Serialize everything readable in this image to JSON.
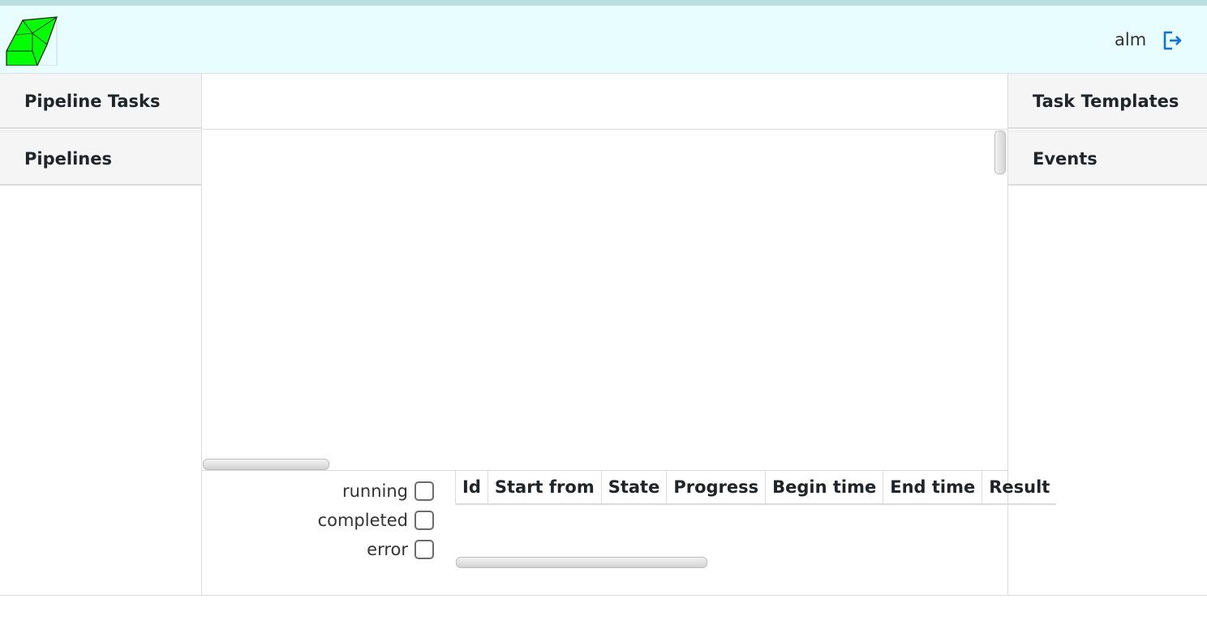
{
  "header": {
    "logo_icon": "green-crystal-logo-icon",
    "user": "alm",
    "logout_icon": "logout-icon",
    "accent_color": "#0d6efd",
    "background_color": "#e8fdff"
  },
  "left_nav": {
    "items": [
      {
        "label": "Pipeline Tasks"
      },
      {
        "label": "Pipelines"
      }
    ]
  },
  "right_nav": {
    "items": [
      {
        "label": "Task Templates"
      },
      {
        "label": "Events"
      }
    ]
  },
  "filters": [
    {
      "label": "running",
      "checked": false
    },
    {
      "label": "completed",
      "checked": false
    },
    {
      "label": "error",
      "checked": false
    }
  ],
  "tasks_table": {
    "columns": [
      "Id",
      "Start from",
      "State",
      "Progress",
      "Begin time",
      "End time",
      "Result"
    ],
    "rows": []
  }
}
